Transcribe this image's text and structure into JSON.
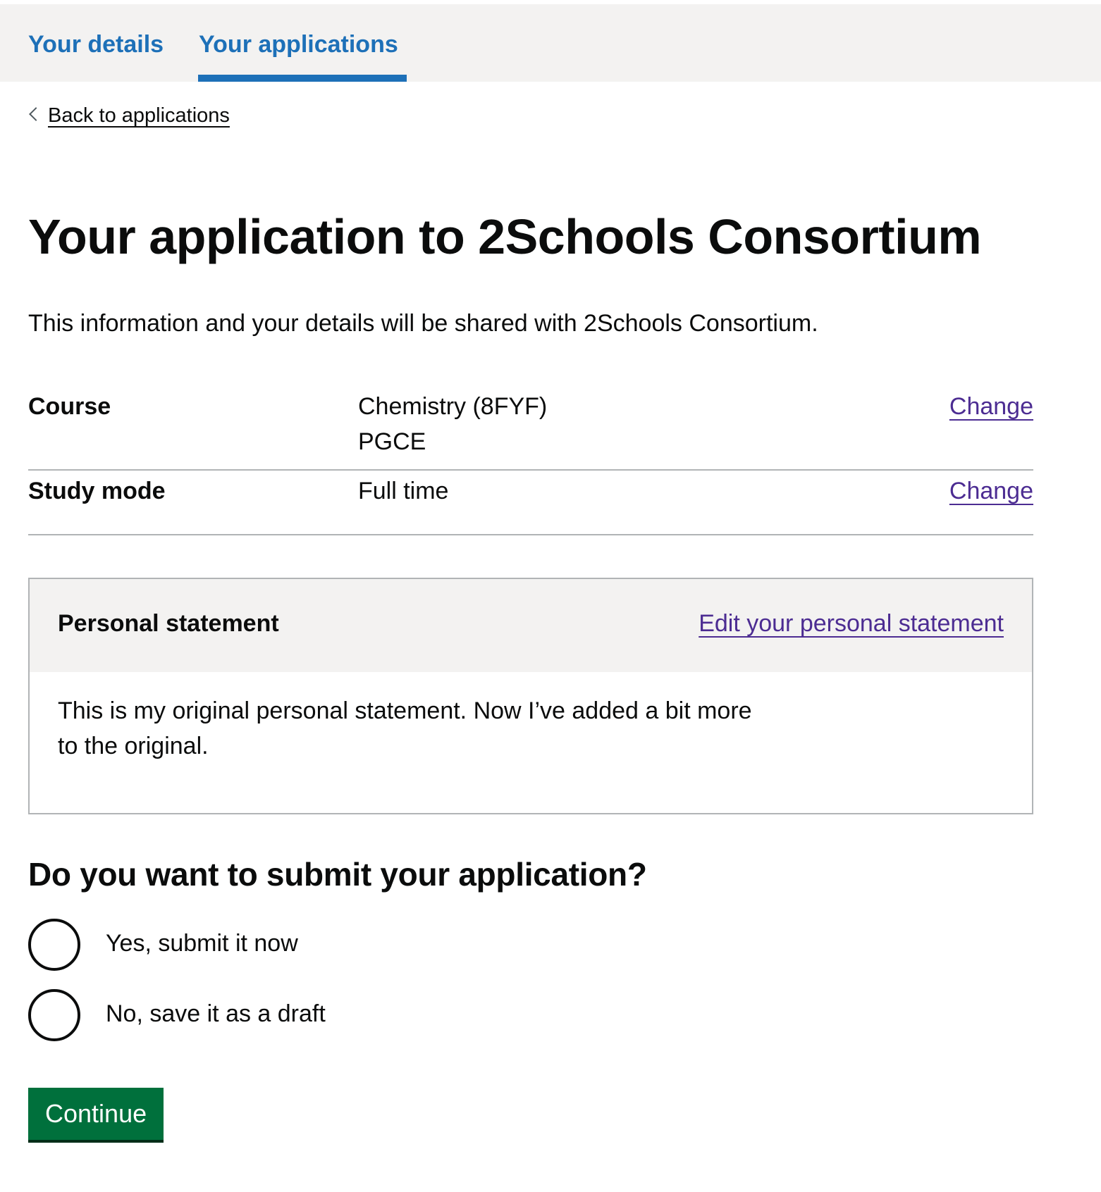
{
  "nav": {
    "tabs": [
      {
        "label": "Your details",
        "active": false
      },
      {
        "label": "Your applications",
        "active": true
      }
    ]
  },
  "back_link": {
    "label": "Back to applications"
  },
  "page": {
    "title": "Your application to 2Schools Consortium",
    "intro": "This information and your details will be shared with 2Schools Consortium."
  },
  "summary": {
    "rows": [
      {
        "key": "Course",
        "value_lines": [
          "Chemistry (8FYF)",
          "PGCE"
        ],
        "action": "Change"
      },
      {
        "key": "Study mode",
        "value_lines": [
          "Full time"
        ],
        "action": "Change"
      }
    ]
  },
  "personal_statement": {
    "title": "Personal statement",
    "action": "Edit your personal statement",
    "body": "This is my original personal statement. Now I’ve added a bit more to the original."
  },
  "question": {
    "legend": "Do you want to submit your application?",
    "options": [
      {
        "label": "Yes, submit it now",
        "selected": false
      },
      {
        "label": "No, save it as a draft",
        "selected": false
      }
    ]
  },
  "actions": {
    "continue_label": "Continue"
  },
  "colors": {
    "link_blue": "#1d70b8",
    "visited_purple": "#4c2c92",
    "button_green": "#00703c",
    "panel_grey": "#f3f2f1",
    "border_grey": "#b1b4b6"
  }
}
